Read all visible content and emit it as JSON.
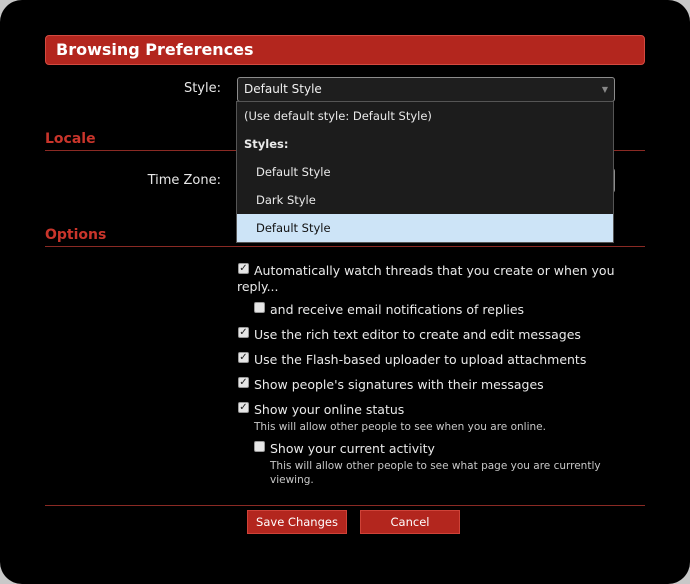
{
  "header": {
    "title": "Browsing Preferences"
  },
  "style": {
    "label": "Style:",
    "selected": "Default Style",
    "options": [
      {
        "label": "(Use default style: Default Style)"
      },
      {
        "label": "Styles:"
      },
      {
        "label": "Default Style"
      },
      {
        "label": "Dark Style"
      },
      {
        "label": "Default Style"
      }
    ]
  },
  "locale": {
    "title": "Locale",
    "timezone_label": "Time Zone:"
  },
  "options": {
    "title": "Options",
    "watch_threads": {
      "label_line1": "Automatically watch threads that you create or when you",
      "label_line2": "reply...",
      "checked": true
    },
    "email_notifications": {
      "label": "and receive email notifications of replies",
      "checked": false
    },
    "rich_text": {
      "label": "Use the rich text editor to create and edit messages",
      "checked": true
    },
    "flash_uploader": {
      "label": "Use the Flash-based uploader to upload attachments",
      "checked": true
    },
    "signatures": {
      "label": "Show people's signatures with their messages",
      "checked": true
    },
    "online_status": {
      "label": "Show your online status",
      "hint": "This will allow other people to see when you are online.",
      "checked": true
    },
    "current_activity": {
      "label": "Show your current activity",
      "hint_line1": "This will allow other people to see what page you are currently",
      "hint_line2": "viewing.",
      "checked": false
    }
  },
  "buttons": {
    "save": "Save Changes",
    "cancel": "Cancel"
  },
  "colors": {
    "accent": "#b3261e",
    "background": "#000000",
    "selected_option": "#cde4f7"
  }
}
